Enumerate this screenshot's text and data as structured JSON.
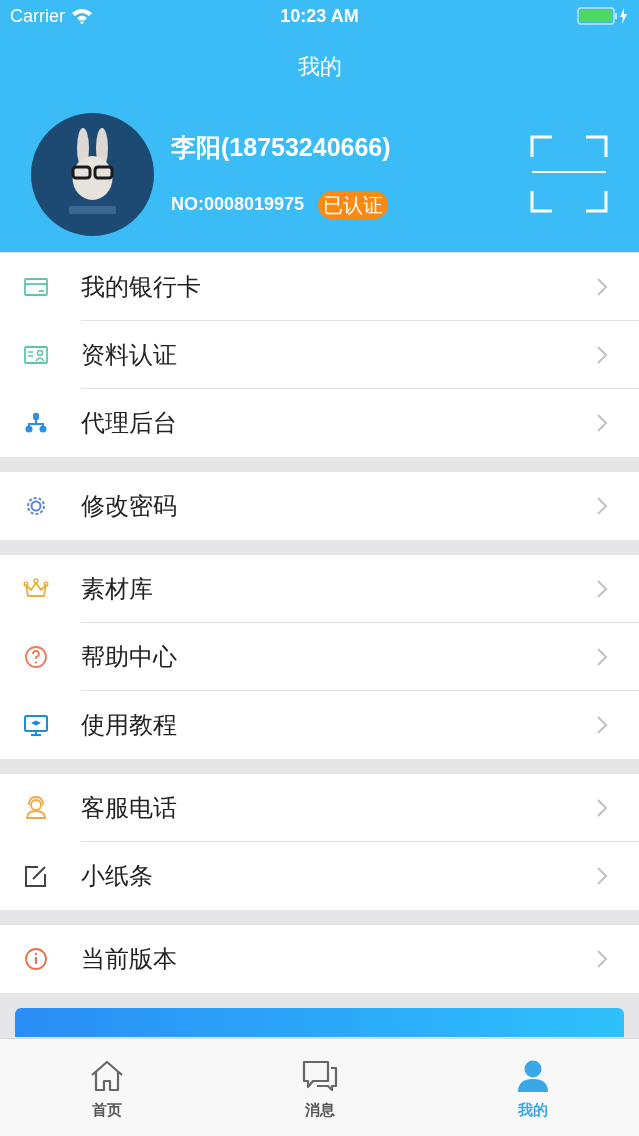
{
  "status_bar": {
    "carrier": "Carrier",
    "time": "10:23 AM"
  },
  "title": "我的",
  "profile": {
    "name": "李阳(18753240666)",
    "number": "NO:0008019975",
    "badge": "已认证"
  },
  "groups": [
    {
      "items": [
        {
          "label": "我的银行卡"
        },
        {
          "label": "资料认证"
        },
        {
          "label": "代理后台"
        }
      ]
    },
    {
      "items": [
        {
          "label": "修改密码"
        }
      ]
    },
    {
      "items": [
        {
          "label": "素材库"
        },
        {
          "label": "帮助中心"
        },
        {
          "label": "使用教程"
        }
      ]
    },
    {
      "items": [
        {
          "label": "客服电话"
        },
        {
          "label": "小纸条"
        }
      ]
    },
    {
      "items": [
        {
          "label": "当前版本"
        }
      ]
    }
  ],
  "tabs": [
    {
      "label": "首页",
      "selected": false
    },
    {
      "label": "消息",
      "selected": false
    },
    {
      "label": "我的",
      "selected": true
    }
  ]
}
